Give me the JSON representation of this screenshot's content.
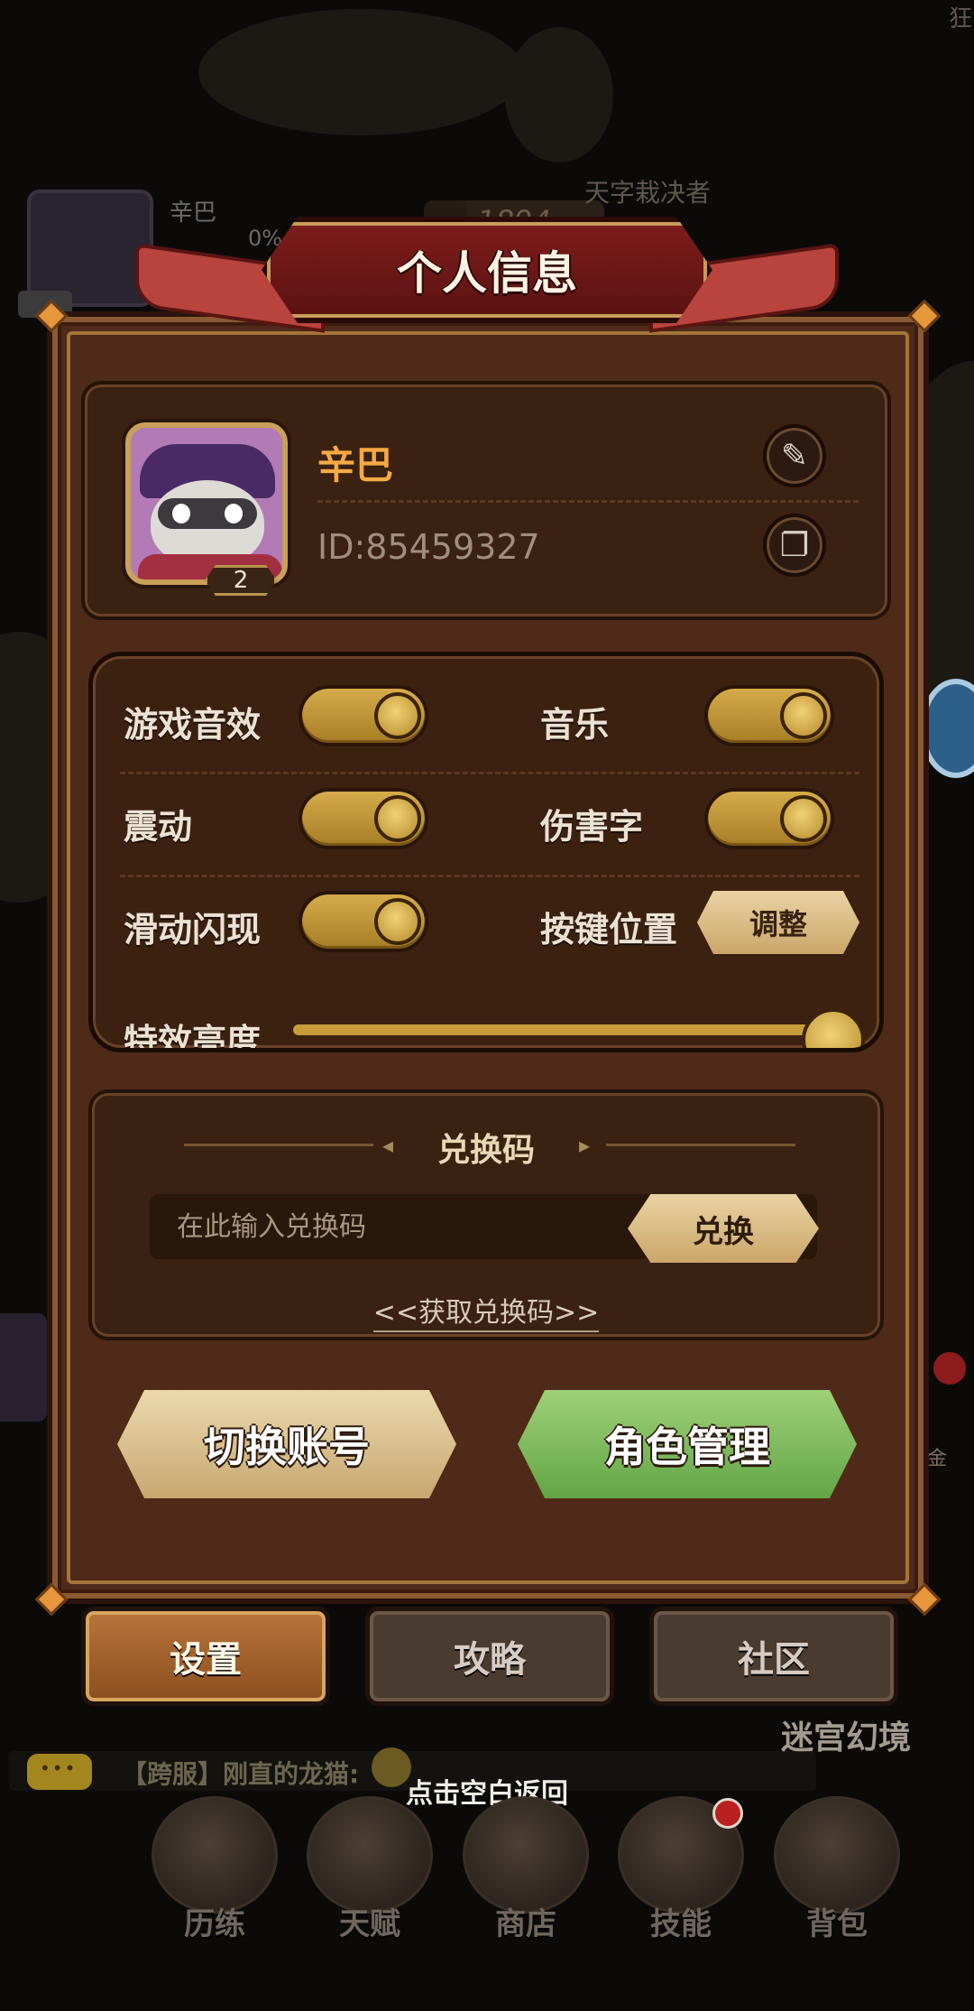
{
  "background": {
    "player_name": "辛巴",
    "player_progress": "0%",
    "score": "1894",
    "top_title": "天字栽决者",
    "top_right_text": "狂",
    "maze_label": "迷宫幻境",
    "right_side_text": "金",
    "chat": {
      "channel_message": "【跨服】刚直的龙猫:"
    },
    "tap_hint": "点击空白返回",
    "bottom_nav": [
      {
        "label": "历练",
        "icon": "training-icon"
      },
      {
        "label": "天赋",
        "icon": "talent-icon"
      },
      {
        "label": "商店",
        "icon": "shop-icon"
      },
      {
        "label": "技能",
        "icon": "skill-book-icon",
        "badge": true
      },
      {
        "label": "背包",
        "icon": "backpack-icon"
      }
    ]
  },
  "dialog": {
    "title": "个人信息",
    "profile": {
      "name": "辛巴",
      "id": "ID:85459327",
      "level": "2",
      "edit_icon": "pencil-icon",
      "copy_icon": "copy-icon"
    },
    "settings": {
      "sound_effects": {
        "label": "游戏音效",
        "on": true
      },
      "music": {
        "label": "音乐",
        "on": true
      },
      "vibration": {
        "label": "震动",
        "on": true
      },
      "damage_numbers": {
        "label": "伤害字",
        "on": true
      },
      "swipe_flash": {
        "label": "滑动闪现",
        "on": true
      },
      "key_position": {
        "label": "按键位置",
        "button": "调整"
      },
      "brightness": {
        "label": "特效亮度",
        "value": 1.0
      }
    },
    "redeem": {
      "title": "兑换码",
      "placeholder": "在此输入兑换码",
      "button": "兑换",
      "get_code_link": "<<获取兑换码>>"
    },
    "actions": {
      "switch_account": "切换账号",
      "role_management": "角色管理"
    },
    "tabs": [
      {
        "label": "设置",
        "active": true
      },
      {
        "label": "攻略",
        "active": false
      },
      {
        "label": "社区",
        "active": false
      }
    ]
  },
  "colors": {
    "panel": "#4f2a19",
    "accent_gold": "#d6ab4a",
    "name_orange": "#f6a945",
    "role_button_green": "#62a546"
  }
}
